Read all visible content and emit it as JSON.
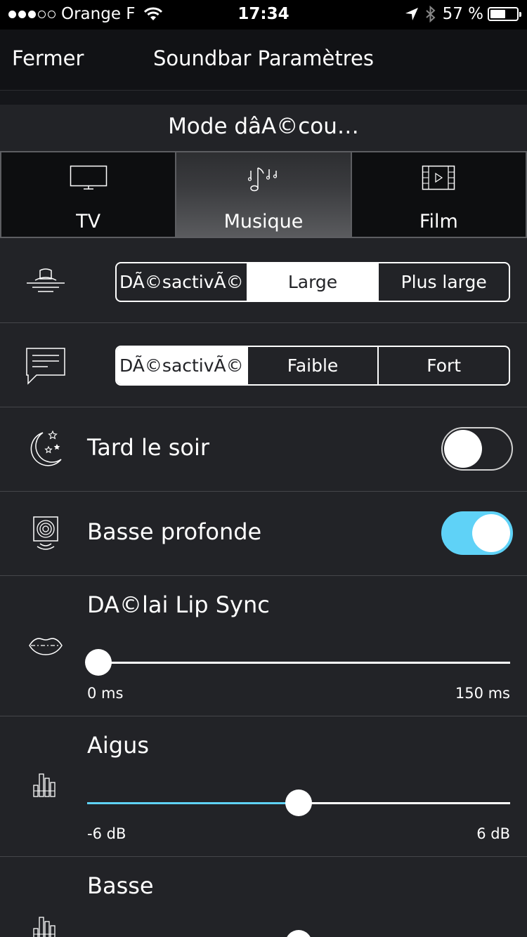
{
  "status_bar": {
    "carrier": "Orange F",
    "time": "17:34",
    "battery": "57 %",
    "battery_level": 0.57,
    "signal_bars_filled": 3,
    "signal_bars_total": 5
  },
  "nav": {
    "close_label": "Fermer",
    "title": "Soundbar Paramètres"
  },
  "mode": {
    "title": "Mode dâA©cou…",
    "tabs": [
      {
        "label": "TV",
        "icon": "tv-icon",
        "active": false
      },
      {
        "label": "Musique",
        "icon": "music-notes-icon",
        "active": true
      },
      {
        "label": "Film",
        "icon": "film-icon",
        "active": false
      }
    ]
  },
  "surround": {
    "icon": "surround-icon",
    "options": [
      "DÃ©sactivÃ©",
      "Large",
      "Plus large"
    ],
    "selected": 1
  },
  "dialogue": {
    "icon": "speech-bubble-icon",
    "options": [
      "DÃ©sactivÃ©",
      "Faible",
      "Fort"
    ],
    "selected": 0
  },
  "late_night": {
    "label": "Tard le soir",
    "icon": "moon-stars-icon",
    "enabled": false
  },
  "deep_bass": {
    "label": "Basse profonde",
    "icon": "subwoofer-icon",
    "enabled": true
  },
  "lip_sync": {
    "label": "DA©lai Lip Sync",
    "icon": "lips-icon",
    "min_label": "0 ms",
    "max_label": "150 ms",
    "value_fraction": 0.0
  },
  "treble": {
    "label": "Aigus",
    "icon": "equalizer-icon",
    "min_label": "-6 dB",
    "max_label": "6 dB",
    "value_fraction": 0.5
  },
  "bass": {
    "label": "Basse",
    "icon": "equalizer-icon",
    "value_fraction": 0.5
  },
  "colors": {
    "accent": "#5fd2f7",
    "background": "#222327",
    "bar": "#111215"
  }
}
